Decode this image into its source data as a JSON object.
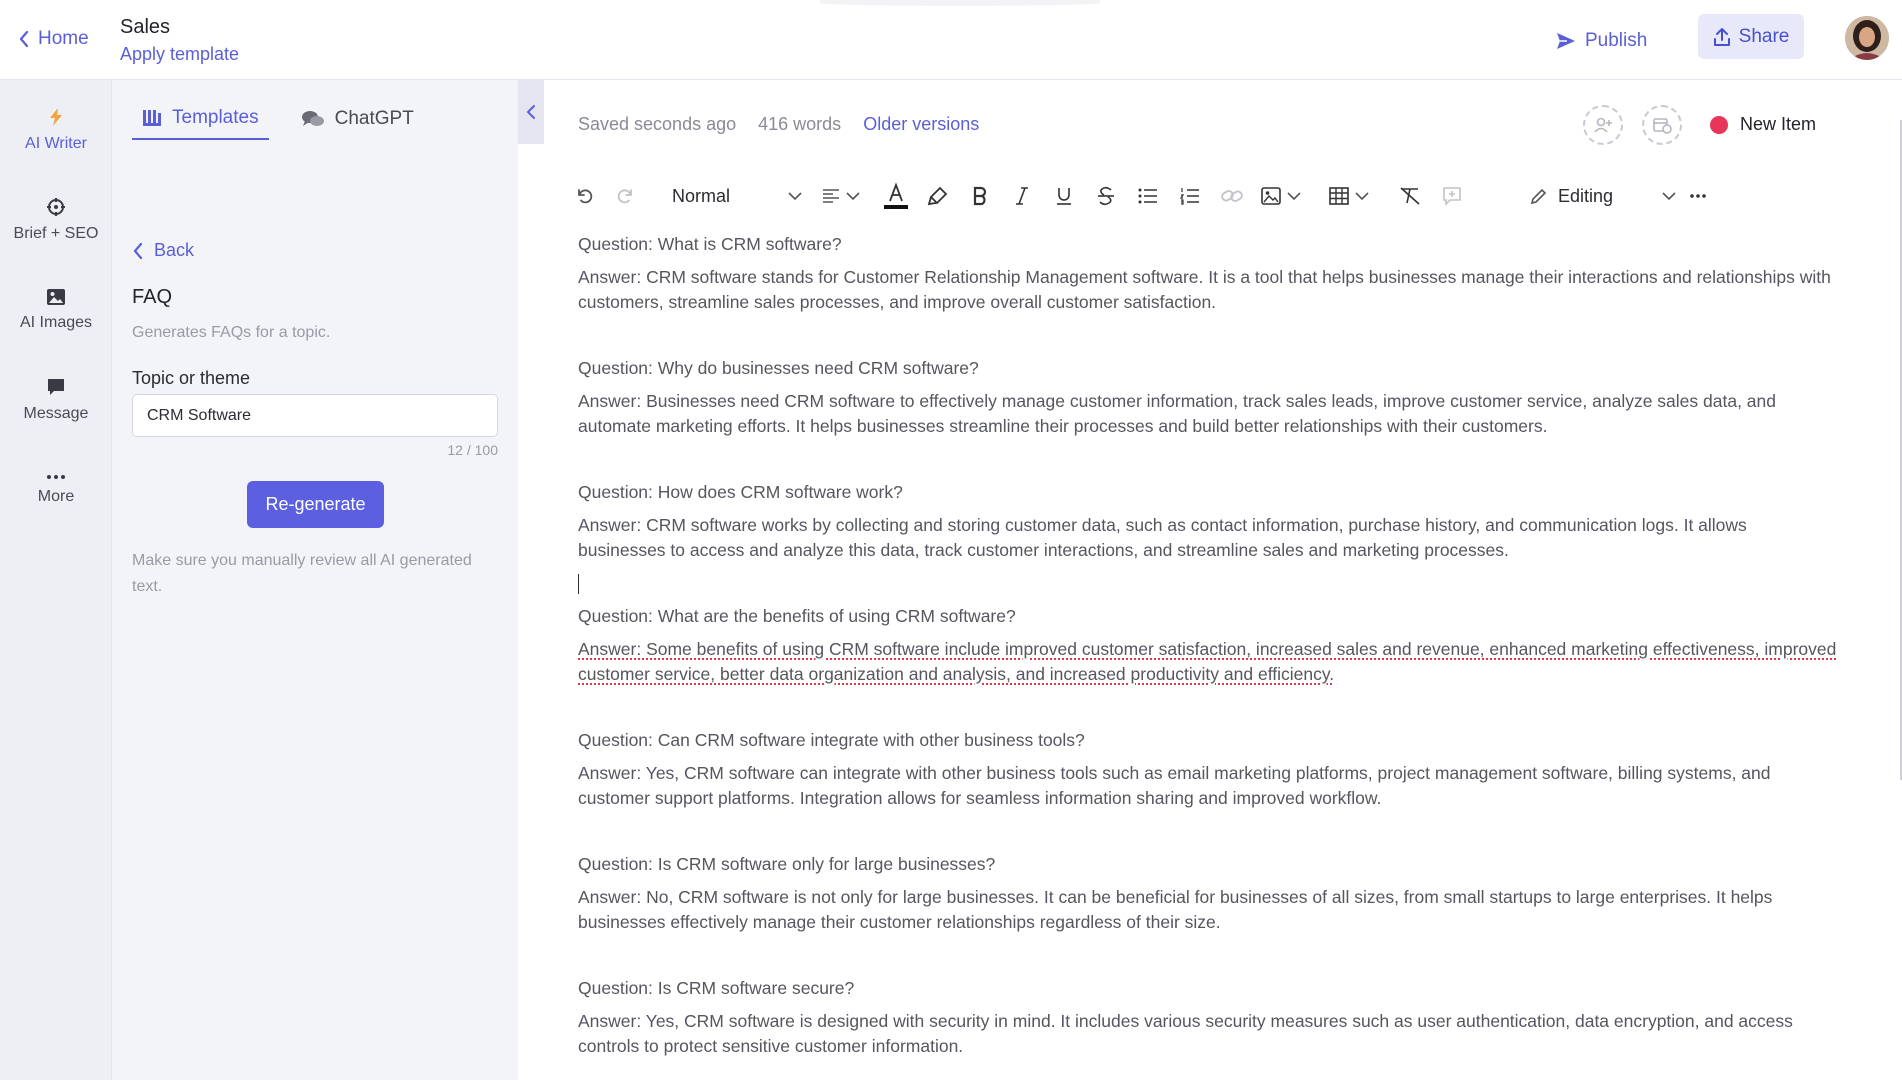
{
  "header": {
    "home_label": "Home",
    "doc_title": "Sales",
    "apply_template_label": "Apply template",
    "publish_label": "Publish",
    "share_label": "Share"
  },
  "rail": {
    "items": [
      {
        "label": "AI Writer",
        "icon": "lightning-icon"
      },
      {
        "label": "Brief + SEO",
        "icon": "crosshair-icon"
      },
      {
        "label": "AI Images",
        "icon": "image-icon"
      },
      {
        "label": "Message",
        "icon": "chat-icon"
      },
      {
        "label": "More",
        "icon": "more-dots-icon"
      }
    ]
  },
  "panel": {
    "tabs": [
      {
        "label": "Templates",
        "icon": "templates-icon"
      },
      {
        "label": "ChatGPT",
        "icon": "chat-bubbles-icon"
      }
    ],
    "back_label": "Back",
    "template_title": "FAQ",
    "template_description": "Generates FAQs for a topic.",
    "field_label": "Topic or theme",
    "field_value": "CRM Software",
    "char_count": "12 / 100",
    "regenerate_label": "Re-generate",
    "disclaimer": "Make sure you manually review all AI generated text."
  },
  "editor": {
    "saved_status": "Saved seconds ago",
    "word_count": "416 words",
    "older_versions_label": "Older versions",
    "new_item_label": "New Item",
    "new_item_color": "#e8365a",
    "toolbar": {
      "style_value": "Normal",
      "mode_value": "Editing"
    },
    "faqs": [
      {
        "question": "Question: What is CRM software?",
        "answer": "Answer: CRM software stands for Customer Relationship Management software. It is a tool that helps businesses manage their interactions and relationships with customers, streamline sales processes, and improve overall customer satisfaction."
      },
      {
        "question": "Question: Why do businesses need CRM software?",
        "answer": "Answer: Businesses need CRM software to effectively manage customer information, track sales leads, improve customer service, analyze sales data, and automate marketing efforts. It helps businesses streamline their processes and build better relationships with their customers."
      },
      {
        "question": "Question: How does CRM software work?",
        "answer": "Answer: CRM software works by collecting and storing customer data, such as contact information, purchase history, and communication logs. It allows businesses to access and analyze this data, track customer interactions, and streamline sales and marketing processes."
      },
      {
        "question": "Question: What are the benefits of using CRM software?",
        "answer": "Answer: Some benefits of using CRM software include improved customer satisfaction, increased sales and revenue, enhanced marketing effectiveness, improved customer service, better data organization and analysis, and increased productivity and efficiency."
      },
      {
        "question": "Question: Can CRM software integrate with other business tools?",
        "answer": "Answer: Yes, CRM software can integrate with other business tools such as email marketing platforms, project management software, billing systems, and customer support platforms. Integration allows for seamless information sharing and improved workflow."
      },
      {
        "question": "Question: Is CRM software only for large businesses?",
        "answer": "Answer: No, CRM software is not only for large businesses. It can be beneficial for businesses of all sizes, from small startups to large enterprises. It helps businesses effectively manage their customer relationships regardless of their size."
      },
      {
        "question": "Question: Is CRM software secure?",
        "answer": "Answer: Yes, CRM software is designed with security in mind. It includes various security measures such as user authentication, data encryption, and access controls to protect sensitive customer information."
      }
    ]
  },
  "colors": {
    "accent": "#5a5fd8",
    "button": "#5b5fe0",
    "share_bg": "#e7e9fb",
    "sidebar_bg": "#eeeff5",
    "panel_bg": "#f3f4f8"
  }
}
